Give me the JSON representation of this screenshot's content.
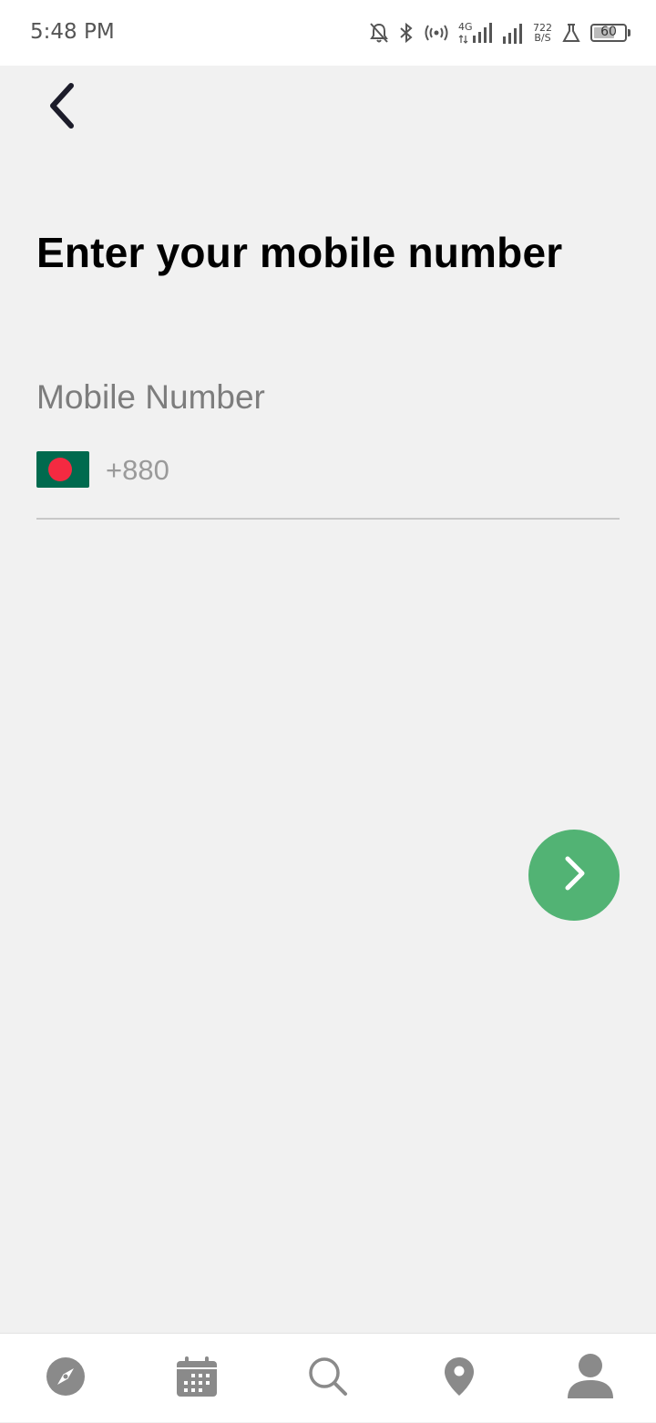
{
  "status_bar": {
    "time": "5:48 PM",
    "net_speed_value": "722",
    "net_speed_unit": "B/S",
    "network_type": "4G",
    "battery_level": "60",
    "icons": [
      "bell-off-icon",
      "bluetooth-icon",
      "hotspot-icon",
      "signal-4g-icon",
      "signal-icon",
      "lab-icon",
      "battery-icon"
    ]
  },
  "header": {
    "back_icon": "chevron-left-icon"
  },
  "main": {
    "title": "Enter your mobile number",
    "field_label": "Mobile Number",
    "country_flag": "bangladesh-flag",
    "phone_placeholder": "+880",
    "phone_value": ""
  },
  "next_button": {
    "icon": "chevron-right-icon",
    "color": "#52b374"
  },
  "bottom_nav": {
    "items": [
      {
        "icon": "compass-icon"
      },
      {
        "icon": "calendar-icon"
      },
      {
        "icon": "search-icon"
      },
      {
        "icon": "location-pin-icon"
      },
      {
        "icon": "user-icon"
      }
    ]
  },
  "colors": {
    "background": "#f1f1f1",
    "accent": "#52b374",
    "flag_green": "#006a4e",
    "flag_red": "#f42a41",
    "nav_icon": "#8a8a8a"
  }
}
